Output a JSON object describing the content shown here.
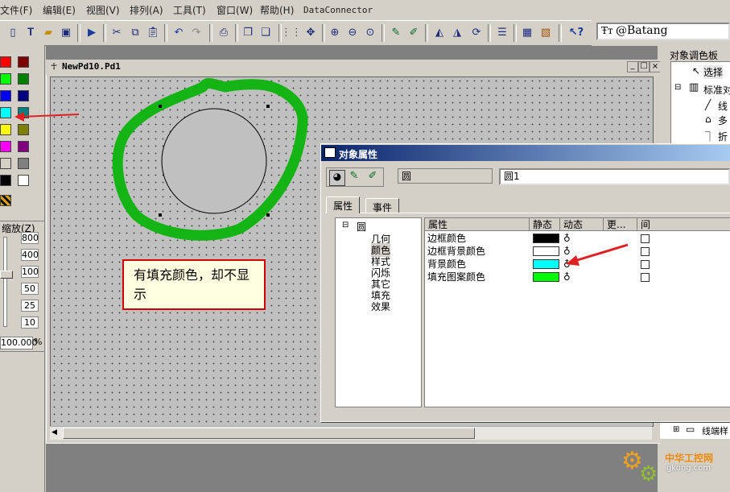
{
  "menu": {
    "items": [
      "文件(F)",
      "编辑(E)",
      "视图(V)",
      "排列(A)",
      "工具(T)",
      "窗口(W)",
      "帮助(H)",
      "DataConnector"
    ]
  },
  "toolbar": {
    "font_value": "@Batang",
    "font_prefix": "Ŧт"
  },
  "left_panel": {
    "swatch_colors": [
      "#ff0000",
      "#800000",
      "#00ff00",
      "#008000",
      "#0000ff",
      "#000080",
      "#00ffff",
      "#008080",
      "#ffff00",
      "#808000",
      "#ff00ff",
      "#800080",
      "#d4d0c8",
      "#808080",
      "#000000",
      "#ffffff"
    ],
    "zoom_label": "缩放(Z)",
    "zoom_levels": [
      "800",
      "400",
      "100",
      "50",
      "25",
      "10"
    ],
    "zoom_value": "100.000",
    "zoom_unit": "%"
  },
  "document": {
    "title": "NewPd10.Pd1"
  },
  "callout": {
    "text": "有填充颜色，却不显示",
    "color": "#d40000"
  },
  "annotation": {
    "stroke_color": "#14b414",
    "arrow_color": "#e02020"
  },
  "dialog": {
    "title": "对象属性",
    "object_type": "圆",
    "object_name": "圆1",
    "tabs": [
      "属性",
      "事件"
    ],
    "tree": {
      "root": "圆",
      "children": [
        "几何",
        "颜色",
        "样式",
        "闪烁",
        "其它",
        "填充",
        "效果"
      ],
      "selected": "颜色"
    },
    "grid": {
      "headers": [
        "属性",
        "静态",
        "动态",
        "更...",
        "间"
      ],
      "rows": [
        {
          "name": "边框颜色",
          "color": "#000000"
        },
        {
          "name": "边框背景颜色",
          "color": "#ffffff"
        },
        {
          "name": "背景颜色",
          "color": "#00ffff"
        },
        {
          "name": "填充图案颜色",
          "color": "#00ff00"
        }
      ]
    }
  },
  "right_panel": {
    "title": "对象调色板",
    "items": [
      "选择",
      "标准对",
      "线",
      "多",
      "折"
    ],
    "bottom_item": "线端样"
  },
  "watermark": {
    "brand": "中华工控网",
    "url": "gkong.com"
  }
}
